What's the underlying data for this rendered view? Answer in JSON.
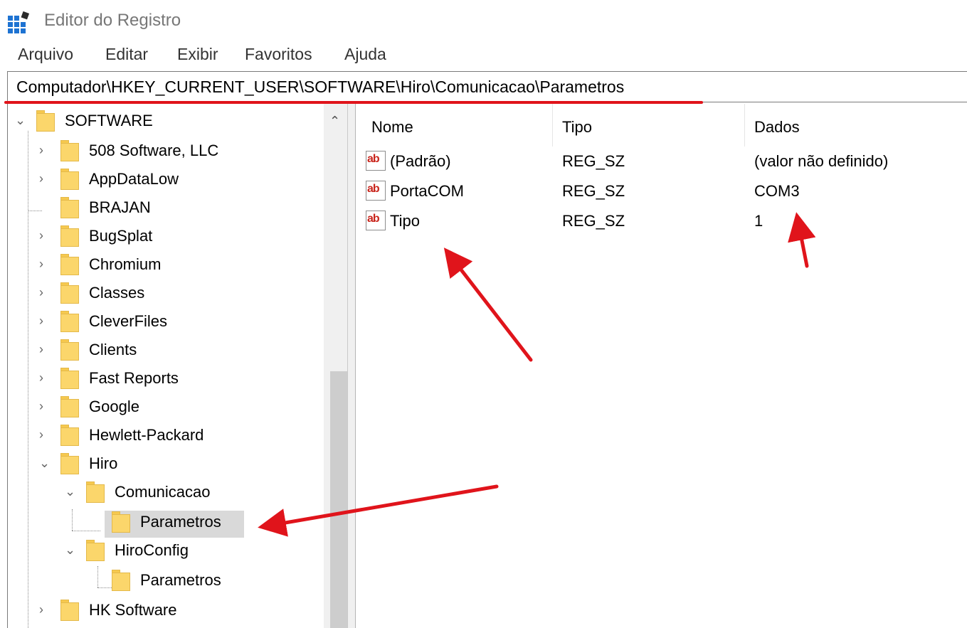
{
  "window": {
    "title": "Editor do Registro",
    "icon": "registry-editor-icon"
  },
  "menu": [
    "Arquivo",
    "Editar",
    "Exibir",
    "Favoritos",
    "Ajuda"
  ],
  "address": "Computador\\HKEY_CURRENT_USER\\SOFTWARE\\Hiro\\Comunicacao\\Parametros",
  "tree": {
    "root": "SOFTWARE",
    "items": [
      "508 Software, LLC",
      "AppDataLow",
      "BRAJAN",
      "BugSplat",
      "Chromium",
      "Classes",
      "CleverFiles",
      "Clients",
      "Fast Reports",
      "Google",
      "Hewlett-Packard",
      "Hiro",
      "Comunicacao",
      "Parametros",
      "HiroConfig",
      "Parametros",
      "HK Software"
    ],
    "selected": "Parametros"
  },
  "list": {
    "columns": [
      "Nome",
      "Tipo",
      "Dados"
    ],
    "rows": [
      {
        "name": "(Padrão)",
        "type": "REG_SZ",
        "data": "(valor não definido)",
        "icon_text": "ab"
      },
      {
        "name": "PortaCOM",
        "type": "REG_SZ",
        "data": "COM3",
        "icon_text": "ab"
      },
      {
        "name": "Tipo",
        "type": "REG_SZ",
        "data": "1",
        "icon_text": "ab"
      }
    ]
  },
  "colors": {
    "annotation": "#e0141b",
    "selection": "#d9d9d9",
    "folder": "#fbd66b"
  }
}
